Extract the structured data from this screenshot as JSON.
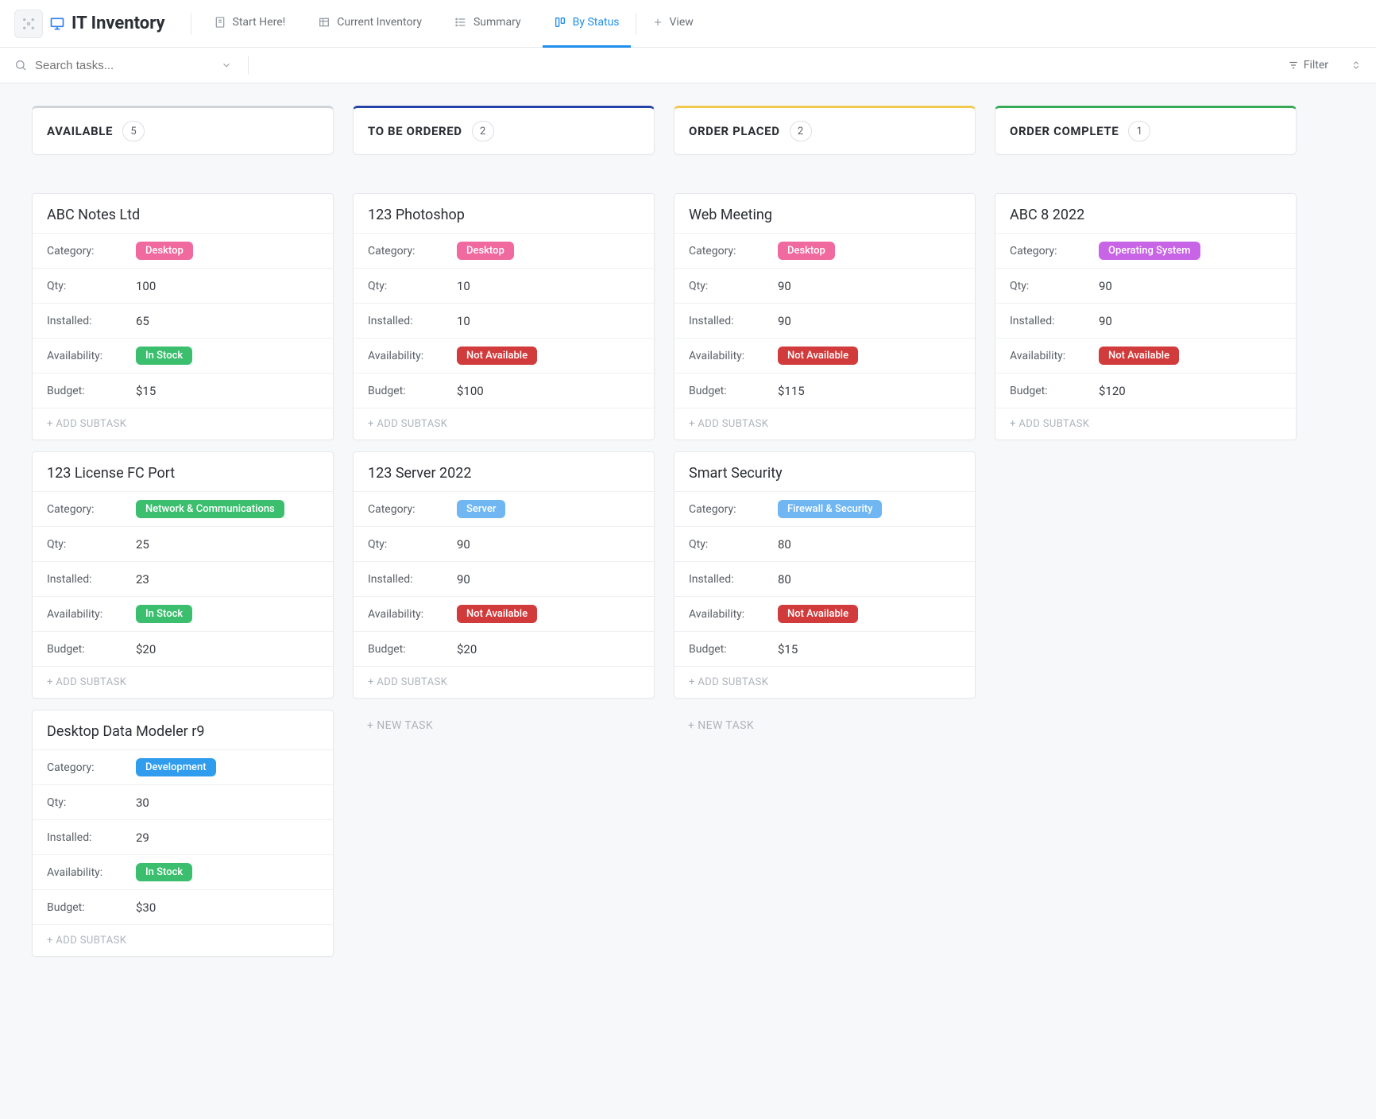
{
  "header": {
    "title": "IT Inventory",
    "tabs": [
      {
        "label": "Start Here!",
        "active": false
      },
      {
        "label": "Current Inventory",
        "active": false
      },
      {
        "label": "Summary",
        "active": false
      },
      {
        "label": "By Status",
        "active": true
      },
      {
        "label": "View",
        "active": false,
        "is_add": true
      }
    ]
  },
  "search": {
    "placeholder": "Search tasks..."
  },
  "toolbar": {
    "filter_label": "Filter"
  },
  "field_labels": {
    "category": "Category:",
    "qty": "Qty:",
    "installed": "Installed:",
    "availability": "Availability:",
    "budget": "Budget:"
  },
  "actions": {
    "add_subtask": "+ ADD SUBTASK",
    "new_task": "+ NEW TASK"
  },
  "tag_colors": {
    "Desktop": "pink",
    "Operating System": "purple",
    "Network & Communications": "greensm",
    "Server": "sky",
    "Development": "blue",
    "Firewall & Security": "sky",
    "In Stock": "green",
    "Not Available": "red"
  },
  "columns": [
    {
      "name": "AVAILABLE",
      "count": 5,
      "accent": "#d0d4d9",
      "show_new_task": false,
      "cards": [
        {
          "title": "ABC Notes Ltd",
          "category": "Desktop",
          "qty": "100",
          "installed": "65",
          "availability": "In Stock",
          "budget": "$15"
        },
        {
          "title": "123 License FC Port",
          "category": "Network & Communications",
          "qty": "25",
          "installed": "23",
          "availability": "In Stock",
          "budget": "$20"
        },
        {
          "title": "Desktop Data Modeler r9",
          "category": "Development",
          "qty": "30",
          "installed": "29",
          "availability": "In Stock",
          "budget": "$30"
        }
      ]
    },
    {
      "name": "TO BE ORDERED",
      "count": 2,
      "accent": "#2343a6",
      "show_new_task": true,
      "cards": [
        {
          "title": "123 Photoshop",
          "category": "Desktop",
          "qty": "10",
          "installed": "10",
          "availability": "Not Available",
          "budget": "$100"
        },
        {
          "title": "123 Server 2022",
          "category": "Server",
          "qty": "90",
          "installed": "90",
          "availability": "Not Available",
          "budget": "$20"
        }
      ]
    },
    {
      "name": "ORDER PLACED",
      "count": 2,
      "accent": "#f2c94c",
      "show_new_task": true,
      "cards": [
        {
          "title": "Web Meeting",
          "category": "Desktop",
          "qty": "90",
          "installed": "90",
          "availability": "Not Available",
          "budget": "$115"
        },
        {
          "title": "Smart Security",
          "category": "Firewall & Security",
          "qty": "80",
          "installed": "80",
          "availability": "Not Available",
          "budget": "$15"
        }
      ]
    },
    {
      "name": "ORDER COMPLETE",
      "count": 1,
      "accent": "#34a853",
      "show_new_task": false,
      "cards": [
        {
          "title": "ABC 8 2022",
          "category": "Operating System",
          "qty": "90",
          "installed": "90",
          "availability": "Not Available",
          "budget": "$120"
        }
      ]
    }
  ]
}
